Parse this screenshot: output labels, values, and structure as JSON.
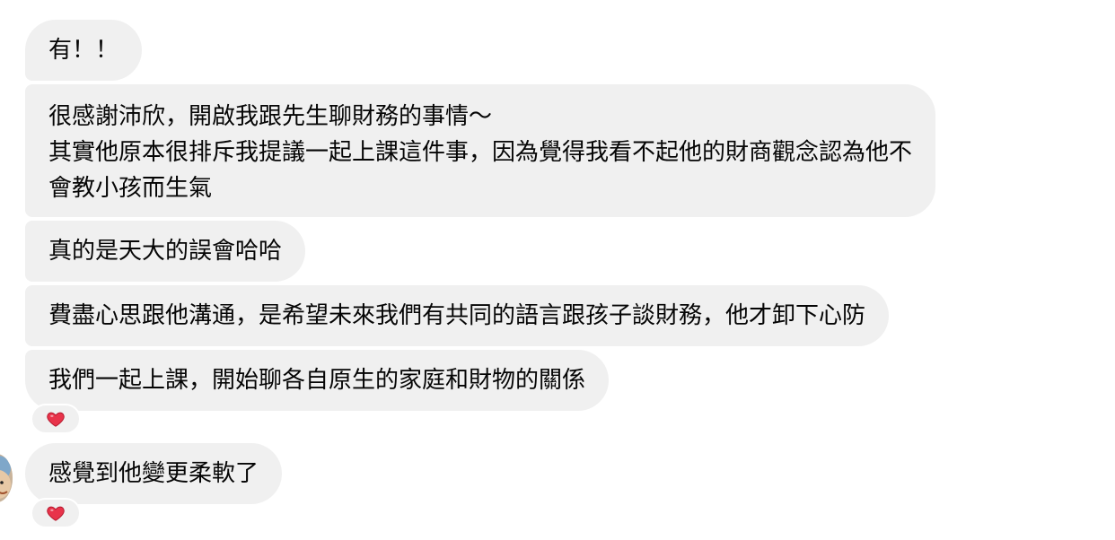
{
  "messages": [
    {
      "lines": [
        "有！！"
      ]
    },
    {
      "lines": [
        "很感謝沛欣，開啟我跟先生聊財務的事情～",
        "其實他原本很排斥我提議一起上課這件事，因為覺得我看不起他的財商觀念認為他不",
        "會教小孩而生氣"
      ]
    },
    {
      "lines": [
        "真的是天大的誤會哈哈"
      ]
    },
    {
      "lines": [
        "費盡心思跟他溝通，是希望未來我們有共同的語言跟孩子談財務，他才卸下心防"
      ]
    },
    {
      "lines": [
        "我們一起上課，開始聊各自原生的家庭和財物的關係"
      ],
      "reaction": "heart-icon"
    },
    {
      "lines": [
        "感覺到他變更柔軟了"
      ],
      "reaction": "heart-icon"
    }
  ],
  "colors": {
    "bubble_bg": "#f0f0f0",
    "text": "#050505",
    "heart": "#e8334a"
  }
}
